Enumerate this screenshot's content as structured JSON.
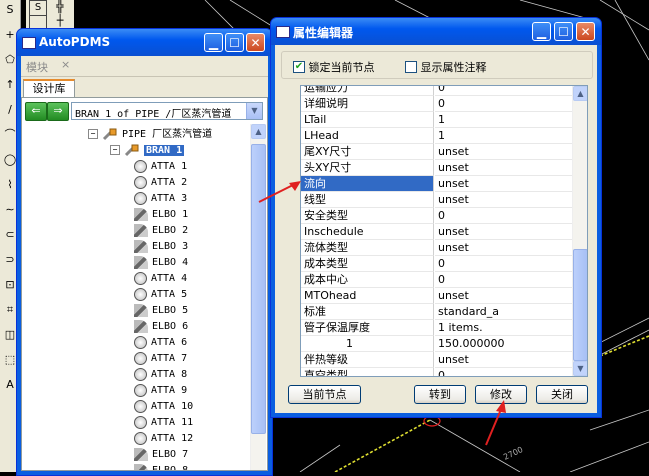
{
  "tree_window": {
    "title": "AutoPDMS",
    "menu_label": "模块",
    "menu_close": "×",
    "tab_label": "设计库",
    "combo_value": "BRAN 1 of PIPE /厂区蒸汽管道",
    "items": [
      {
        "label": "PIPE 厂区蒸汽管道",
        "kind": "pipe",
        "depth": 0
      },
      {
        "label": "BRAN 1",
        "kind": "bran",
        "depth": 1,
        "selected": true
      },
      {
        "label": "ATTA 1",
        "kind": "atta",
        "depth": 2
      },
      {
        "label": "ATTA 2",
        "kind": "atta",
        "depth": 2
      },
      {
        "label": "ATTA 3",
        "kind": "atta",
        "depth": 2
      },
      {
        "label": "ELBO 1",
        "kind": "elbo",
        "depth": 2
      },
      {
        "label": "ELBO 2",
        "kind": "elbo",
        "depth": 2
      },
      {
        "label": "ELBO 3",
        "kind": "elbo",
        "depth": 2
      },
      {
        "label": "ELBO 4",
        "kind": "elbo",
        "depth": 2
      },
      {
        "label": "ATTA 4",
        "kind": "atta",
        "depth": 2
      },
      {
        "label": "ATTA 5",
        "kind": "atta",
        "depth": 2
      },
      {
        "label": "ELBO 5",
        "kind": "elbo",
        "depth": 2
      },
      {
        "label": "ELBO 6",
        "kind": "elbo",
        "depth": 2
      },
      {
        "label": "ATTA 6",
        "kind": "atta",
        "depth": 2
      },
      {
        "label": "ATTA 7",
        "kind": "atta",
        "depth": 2
      },
      {
        "label": "ATTA 8",
        "kind": "atta",
        "depth": 2
      },
      {
        "label": "ATTA 9",
        "kind": "atta",
        "depth": 2
      },
      {
        "label": "ATTA 10",
        "kind": "atta",
        "depth": 2
      },
      {
        "label": "ATTA 11",
        "kind": "atta",
        "depth": 2
      },
      {
        "label": "ATTA 12",
        "kind": "atta",
        "depth": 2
      },
      {
        "label": "ELBO 7",
        "kind": "elbo",
        "depth": 2
      },
      {
        "label": "ELBO 8",
        "kind": "elbo",
        "depth": 2
      }
    ]
  },
  "prop_editor": {
    "title": "属性编辑器",
    "lock_label": "锁定当前节点",
    "lock_checked": true,
    "show_notes_label": "显示属性注释",
    "show_notes_checked": false,
    "rows": [
      {
        "name": "运输应力",
        "value": "0"
      },
      {
        "name": "详细说明",
        "value": "0"
      },
      {
        "name": "LTail",
        "value": "1"
      },
      {
        "name": "LHead",
        "value": "1"
      },
      {
        "name": "尾XY尺寸",
        "value": "unset"
      },
      {
        "name": "头XY尺寸",
        "value": "unset"
      },
      {
        "name": "流向",
        "value": "unset",
        "highlight": true
      },
      {
        "name": "线型",
        "value": "unset"
      },
      {
        "name": "安全类型",
        "value": "0"
      },
      {
        "name": "Inschedule",
        "value": "unset"
      },
      {
        "name": "流体类型",
        "value": "unset"
      },
      {
        "name": "成本类型",
        "value": "0"
      },
      {
        "name": "成本中心",
        "value": "0"
      },
      {
        "name": "MTOhead",
        "value": "unset"
      },
      {
        "name": "标准",
        "value": "standard_a"
      },
      {
        "name": "管子保温厚度",
        "value": "1 items."
      },
      {
        "name": "1",
        "value": "150.000000",
        "indent": true
      },
      {
        "name": "伴热等级",
        "value": "unset"
      },
      {
        "name": "直空类型",
        "value": "0"
      }
    ],
    "buttons": {
      "current_node": "当前节点",
      "goto": "转到",
      "modify": "修改",
      "close": "关闭"
    }
  },
  "toolbar_glyphs": [
    "S",
    "+",
    "⬠",
    "↑",
    "/",
    "⌒",
    "◯",
    "⌇",
    "∼",
    "⊂",
    "⊃",
    "⊡",
    "⌗",
    "◫",
    "⬚",
    "A"
  ],
  "colors": {
    "titlebar": "#0058ee",
    "highlight": "#316ac5",
    "arrow": "#e02020",
    "cad_bg": "#000000"
  }
}
